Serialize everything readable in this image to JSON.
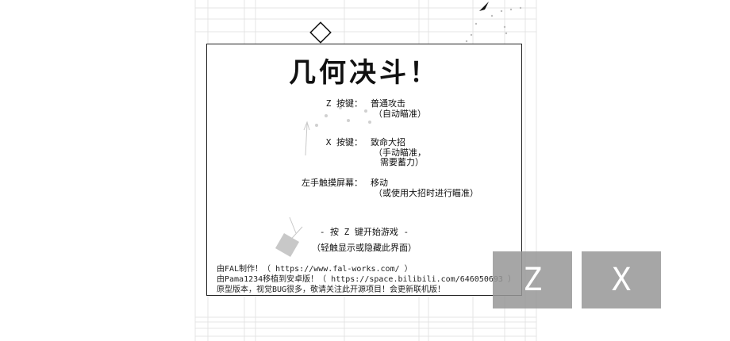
{
  "game": {
    "title": "几何决斗！",
    "controls": [
      {
        "key": "Z 按键：",
        "action_line1": "普通攻击",
        "action_line2": "（自动瞄准）",
        "action_line3": ""
      },
      {
        "key": "X 按键：",
        "action_line1": "致命大招",
        "action_line2": "（手动瞄准，",
        "action_line3": "需要蓄力）"
      },
      {
        "key": "左手触摸屏幕：",
        "action_line1": "移动",
        "action_line2": "（或使用大招时进行瞄准）",
        "action_line3": ""
      }
    ],
    "start_prompt": "- 按 Z 键开始游戏 -",
    "toggle_hint": "（轻触显示或隐藏此界面）",
    "credits": [
      "由FAL制作！（ https://www.fal-works.com/ ）",
      "由Pama1234移植到安卓版！（ https://space.bilibili.com/646050693 ）",
      "原型版本，视觉BUG很多，敬请关注此开源项目！会更新联机版！"
    ]
  },
  "touch_buttons": {
    "z_label": "Z",
    "x_label": "X"
  },
  "colors": {
    "background": "#ffffff",
    "grid": "#e6e6e6",
    "panel_border": "#222222",
    "button_fill": "#969696",
    "button_text": "#ffffff"
  }
}
